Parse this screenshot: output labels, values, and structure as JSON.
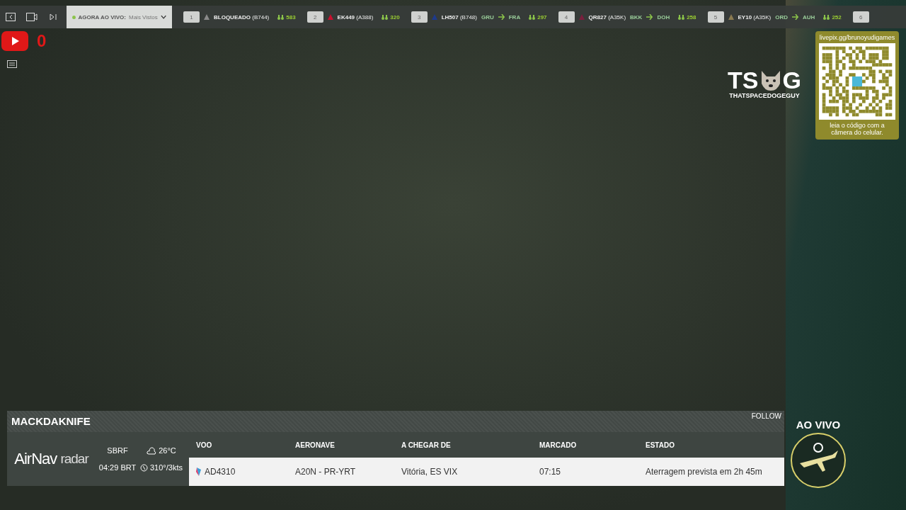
{
  "top_bar": {
    "feed": {
      "label": "AGORA AO VIVO:",
      "value": "Mais Vistos"
    },
    "flights": [
      {
        "rank": "1",
        "flight": "BLOQUEADO",
        "aircraft": "(B744)",
        "views": "583",
        "color": "#8a8a8a"
      },
      {
        "rank": "2",
        "flight": "EK449",
        "aircraft": "(A388)",
        "views": "320",
        "color": "#c8102e"
      },
      {
        "rank": "3",
        "flight": "LH507",
        "aircraft": "(B748)",
        "route": {
          "from": "GRU",
          "to": "FRA"
        },
        "views": "297",
        "color": "#1e3a8a"
      },
      {
        "rank": "4",
        "flight": "QR827",
        "aircraft": "(A35K)",
        "route": {
          "from": "BKK",
          "to": "DOH"
        },
        "views": "258",
        "color": "#7a1f3d"
      },
      {
        "rank": "5",
        "flight": "EY10",
        "aircraft": "(A35K)",
        "route": {
          "from": "ORD",
          "to": "AUH"
        },
        "views": "252",
        "color": "#8a7a50"
      },
      {
        "rank": "6"
      }
    ]
  },
  "youtube": {
    "count": "0"
  },
  "brand": {
    "left": "TS",
    "right": "G",
    "tagline": "THATSPACEDOGEGUY"
  },
  "qr_card": {
    "url": "livepix.gg/brunoyudigames",
    "caption": "leia o código com a câmera do celular."
  },
  "flight_panel": {
    "callsign": "MACKDAKNIFE",
    "follow": "FOLLOW",
    "logo": {
      "bold": "AirNav",
      "light": "radar"
    },
    "airport": "SBRF",
    "time": "04:29 BRT",
    "temperature": "26°C",
    "wind": "310°/3kts",
    "columns": [
      "VOO",
      "AERONAVE",
      "A CHEGAR DE",
      "MARCADO",
      "ESTADO"
    ],
    "row": [
      "AD4310",
      "A20N - PR-YRT",
      "Vitória, ES VIX",
      "07:15",
      "Aterragem prevista em 2h 45m"
    ]
  },
  "live": {
    "label": "AO VIVO"
  }
}
